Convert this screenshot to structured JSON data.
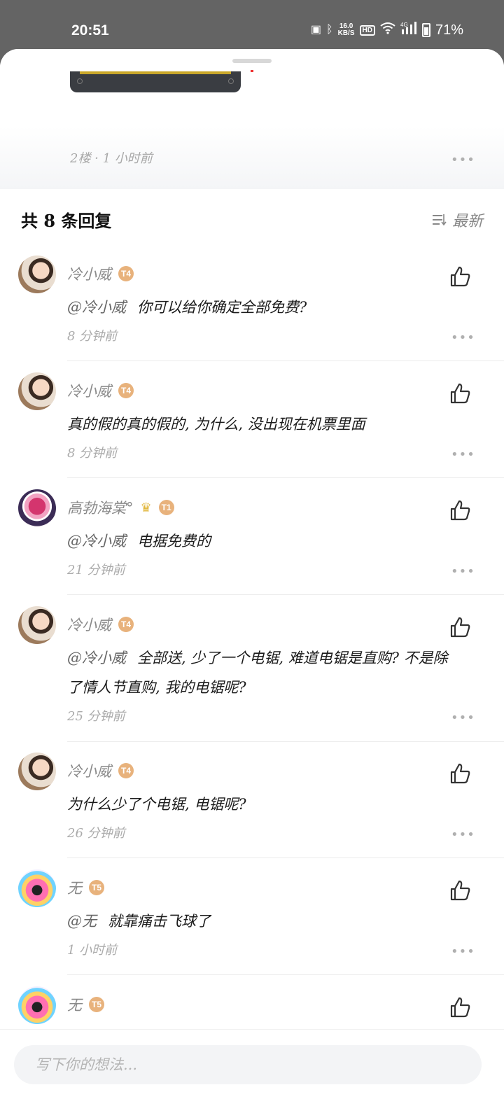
{
  "status_bar": {
    "time": "20:51",
    "net_speed_value": "16.0",
    "net_speed_unit": "KB/S",
    "hd": "HD",
    "signal_label": "4G",
    "battery": "71%"
  },
  "post": {
    "floor_meta": "2楼 · 1 小时前",
    "more": "•••"
  },
  "replies": {
    "title": "共 8 条回复",
    "sort_label": "最新"
  },
  "comments": [
    {
      "user": "冷小威",
      "badge": "T4",
      "avatar": "baby",
      "mention": "@冷小威",
      "text": "你可以给你确定全部免费?",
      "time": "8 分钟前"
    },
    {
      "user": "冷小威",
      "badge": "T4",
      "avatar": "baby",
      "mention": "",
      "text": "真的假的真的假的, 为什么, 没出现在机票里面",
      "time": "8 分钟前"
    },
    {
      "user": "高勃海棠°",
      "badge": "T1",
      "avatar": "pink",
      "crown": "♛",
      "mention": "@冷小威",
      "text": "电据免费的",
      "time": "21 分钟前"
    },
    {
      "user": "冷小威",
      "badge": "T4",
      "avatar": "baby",
      "mention": "@冷小威",
      "text": "全部送, 少了一个电锯, 难道电锯是直购? 不是除了情人节直购, 我的电锯呢?",
      "time": "25 分钟前"
    },
    {
      "user": "冷小威",
      "badge": "T4",
      "avatar": "baby",
      "mention": "",
      "text": "为什么少了个电锯, 电锯呢?",
      "time": "26 分钟前"
    },
    {
      "user": "无",
      "badge": "T5",
      "avatar": "mask",
      "mention": "@无",
      "text": "就靠痛击飞球了",
      "time": "1 小时前"
    },
    {
      "user": "无",
      "badge": "T5",
      "avatar": "mask",
      "mention": "",
      "text": "",
      "time": ""
    }
  ],
  "input": {
    "placeholder": "写下你的想法..."
  },
  "colors": {
    "badge": "#e8b27c",
    "muted_text": "#a8a8a8",
    "body_text": "#1b1b1b"
  },
  "icons": [
    "nfc-icon",
    "bluetooth-icon",
    "wifi-icon",
    "signal-icon",
    "battery-icon",
    "sort-icon",
    "thumbs-up-icon",
    "more-icon"
  ]
}
